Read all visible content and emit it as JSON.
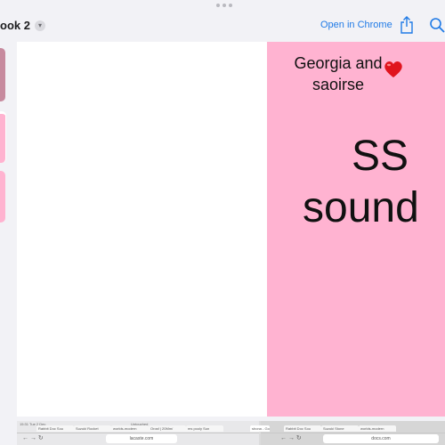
{
  "header": {
    "doc_title": "ook 2",
    "open_in_chrome": "Open in Chrome"
  },
  "slide": {
    "names_line1": "Georgia and",
    "names_line2": "saoirse",
    "big_line1": "SS",
    "big_line2": "sound"
  },
  "colors": {
    "pink": "#ffb3d1",
    "accent": "#1f7ae6",
    "heart": "#e0141e"
  },
  "icons": [
    "chevron-down-icon",
    "share-icon",
    "search-icon",
    "heart-icon"
  ],
  "bottom_strip": {
    "left_time": "15:31  Tue 2 Dec",
    "left_center": "Untouched",
    "left_tabs": [
      "Rabbit Doc Sou",
      "Suzuki Rocket",
      "worlds-modern",
      "Orosf | 20Mm/",
      "ms pooly Sun"
    ],
    "left_url": "lacaste.com",
    "right_tabs": [
      "Rabbit Doc Sou",
      "Suzuki Stone",
      "worlds-modern"
    ],
    "right_tab_active": "shona - Goog",
    "right_url": "docs.com"
  }
}
